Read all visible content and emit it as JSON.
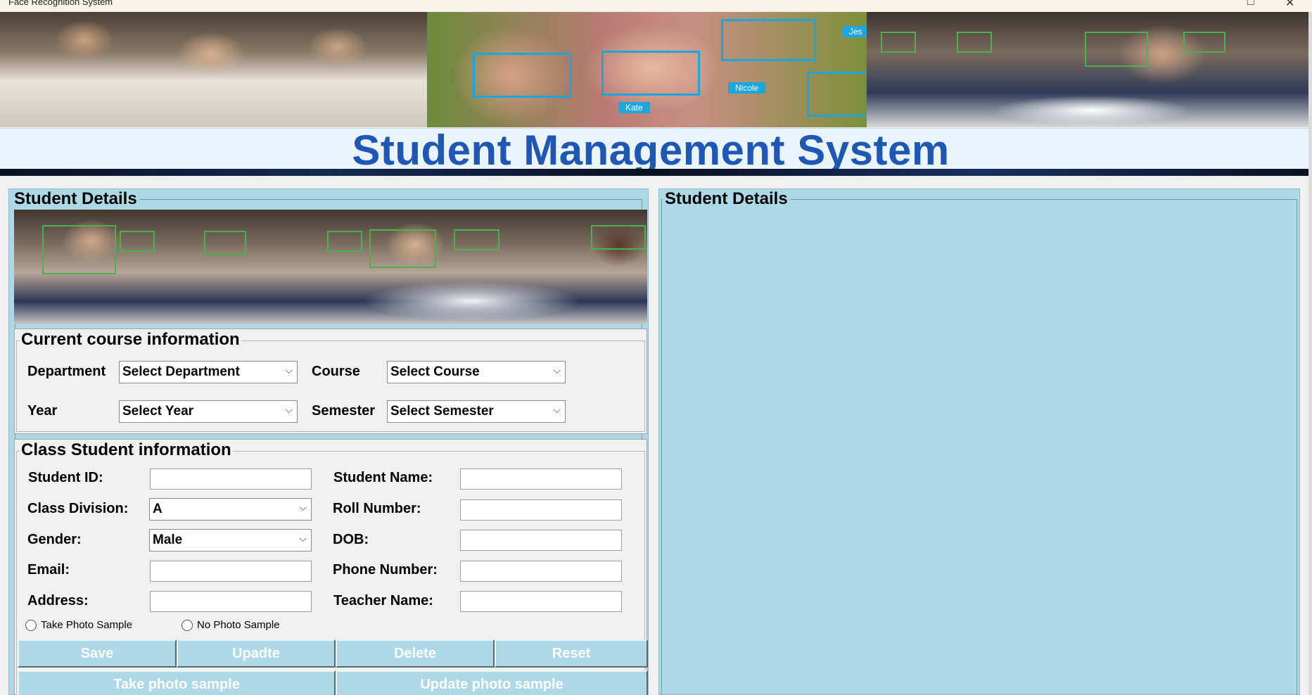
{
  "window": {
    "title": "Face Recognition System",
    "maximize_glyph": "□",
    "close_glyph": "✕"
  },
  "banner": {
    "face_labels": [
      "Kate",
      "Nicole",
      "Jes"
    ]
  },
  "header": {
    "title": "Student Management System",
    "title_color": "#1f57b5"
  },
  "left_panel": {
    "legend": "Student Details",
    "course_info": {
      "legend": "Current course information",
      "department_label": "Department",
      "department_value": "Select Department",
      "course_label": "Course",
      "course_value": "Select Course",
      "year_label": "Year",
      "year_value": "Select Year",
      "semester_label": "Semester",
      "semester_value": "Select Semester"
    },
    "student_info": {
      "legend": "Class Student information",
      "student_id_label": "Student ID:",
      "student_name_label": "Student Name:",
      "class_division_label": "Class Division:",
      "class_division_value": "A",
      "roll_number_label": "Roll Number:",
      "gender_label": "Gender:",
      "gender_value": "Male",
      "dob_label": "DOB:",
      "email_label": "Email:",
      "phone_label": "Phone Number:",
      "address_label": "Address:",
      "teacher_label": "Teacher Name:",
      "radio_take": "Take Photo Sample",
      "radio_no": "No Photo Sample"
    },
    "buttons": {
      "save": "Save",
      "update": "Upadte",
      "delete": "Delete",
      "reset": "Reset",
      "take_photo": "Take photo sample",
      "update_photo": "Update photo sample"
    }
  },
  "right_panel": {
    "legend": "Student Details"
  },
  "colors": {
    "panel_bg": "#add8e6",
    "button_bg": "#add8e6",
    "button_text": "#ffffff",
    "face_box": "#1aa7e0"
  }
}
